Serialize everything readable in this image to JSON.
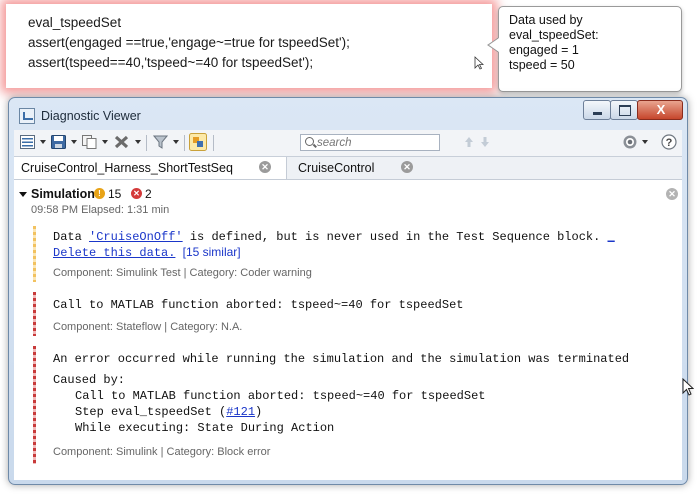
{
  "snippet": {
    "line1": "eval_tspeedSet",
    "line2": "assert(engaged ==true,'engage~=true for tspeedSet');",
    "line3": "assert(tspeed==40,'tspeed~=40 for tspeedSet');"
  },
  "tooltip": {
    "line1": "Data used by",
    "line2": "eval_tspeedSet:",
    "line3": "engaged = 1",
    "line4": "tspeed = 50"
  },
  "window": {
    "title": "Diagnostic Viewer",
    "close_glyph": "X"
  },
  "toolbar": {
    "search_placeholder": "search"
  },
  "tabs": [
    {
      "label": "CruiseControl_Harness_ShortTestSeq"
    },
    {
      "label": "CruiseControl"
    }
  ],
  "simulation": {
    "label": "Simulation",
    "warning_count": "15",
    "error_count": "2",
    "time": "09:58 PM  Elapsed: 1:31 min"
  },
  "messages": [
    {
      "text_pre": "Data ",
      "link": "'CruiseOnOff'",
      "text_post": " is defined, but is never used in the Test Sequence block. ",
      "link2": "_",
      "link3": "Delete this data.",
      "similar": "[15 similar]",
      "meta": "Component: Simulink Test | Category: Coder warning"
    },
    {
      "text": "Call to MATLAB function aborted: tspeed~=40 for tspeedSet",
      "meta": "Component: Stateflow | Category: N.A."
    },
    {
      "text": "An error occurred while running the simulation and the simulation was terminated",
      "caused": "Caused by:",
      "sub1": "Call to MATLAB function aborted: tspeed~=40 for tspeedSet",
      "sub2_pre": "Step eval_tspeedSet (",
      "sub2_link": "#121",
      "sub2_post": ")",
      "sub3": "While executing: State During Action",
      "meta": "Component: Simulink | Category: Block error"
    }
  ],
  "colors": {
    "highlight": "#eb4646",
    "warning": "#e8a317",
    "error": "#d43a3a",
    "link": "#1a36c9"
  }
}
